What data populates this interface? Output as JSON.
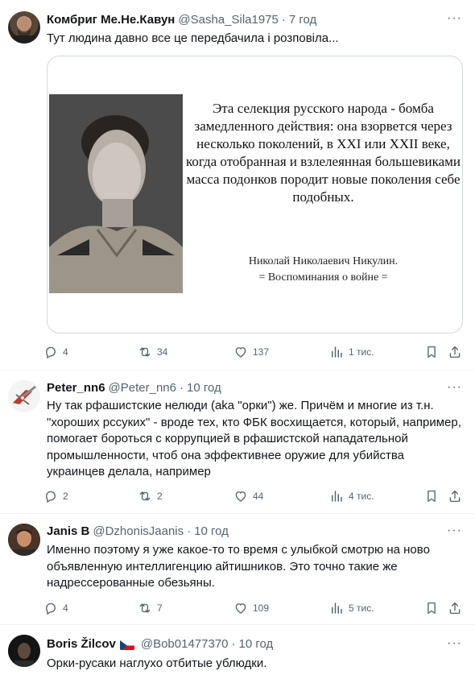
{
  "tweets": [
    {
      "name": "Комбриг Ме.Не.Кавун",
      "handle": "@Sasha_Sila1975",
      "time": "7 год",
      "text": "Тут людина давно все це передбачила і розповіла...",
      "image": {
        "quote": "Эта селекция русского народа - бомба замедленного действия: она взорвется через несколько поколений, в XXI или XXII веке, когда отобранная и взлелеянная большевиками масса подонков породит новые поколения себе подобных.",
        "author_name": "Николай Николаевич Никулин.",
        "author_book": "= Воспоминания о войне ="
      },
      "replies": "4",
      "retweets": "34",
      "likes": "137",
      "views": "1 тис."
    },
    {
      "name": "Peter_nn6",
      "handle": "@Peter_nn6",
      "time": "10 год",
      "text": "Ну так рфашистские нелюди (aka \"орки\") же. Причём и многие из т.н. \"хороших рссуких\" - вроде тех, кто ФБК восхищается, который, например, помогает бороться с коррупцией в рфашистской нападательной промышленности, чтоб она эффективнее оружие для убийства украинцев делала, например",
      "replies": "2",
      "retweets": "2",
      "likes": "44",
      "views": "4 тис."
    },
    {
      "name": "Janis B",
      "handle": "@DzhonisJaanis",
      "time": "10 год",
      "text": "Именно поэтому я уже какое-то то время с улыбкой смотрю на ново объявленную интеллигенцию айтишников. Это точно такие же надрессерованные обезьяны.",
      "replies": "4",
      "retweets": "7",
      "likes": "109",
      "views": "5 тис."
    },
    {
      "name": "Boris Žilcov",
      "handle": "@Bob01477370",
      "time": "10 год",
      "text": "Орки-русаки наглухо отбитые ублюдки."
    }
  ],
  "icons": {
    "reply": "reply-icon",
    "retweet": "retweet-icon",
    "like": "heart-icon",
    "views": "views-icon",
    "bookmark": "bookmark-icon",
    "share": "share-icon",
    "more": "more-icon",
    "flag": "czech-flag-icon"
  },
  "colors": {
    "text": "#0f1419",
    "secondary": "#536471",
    "border": "#cfd9de",
    "divider": "#eff3f4"
  }
}
